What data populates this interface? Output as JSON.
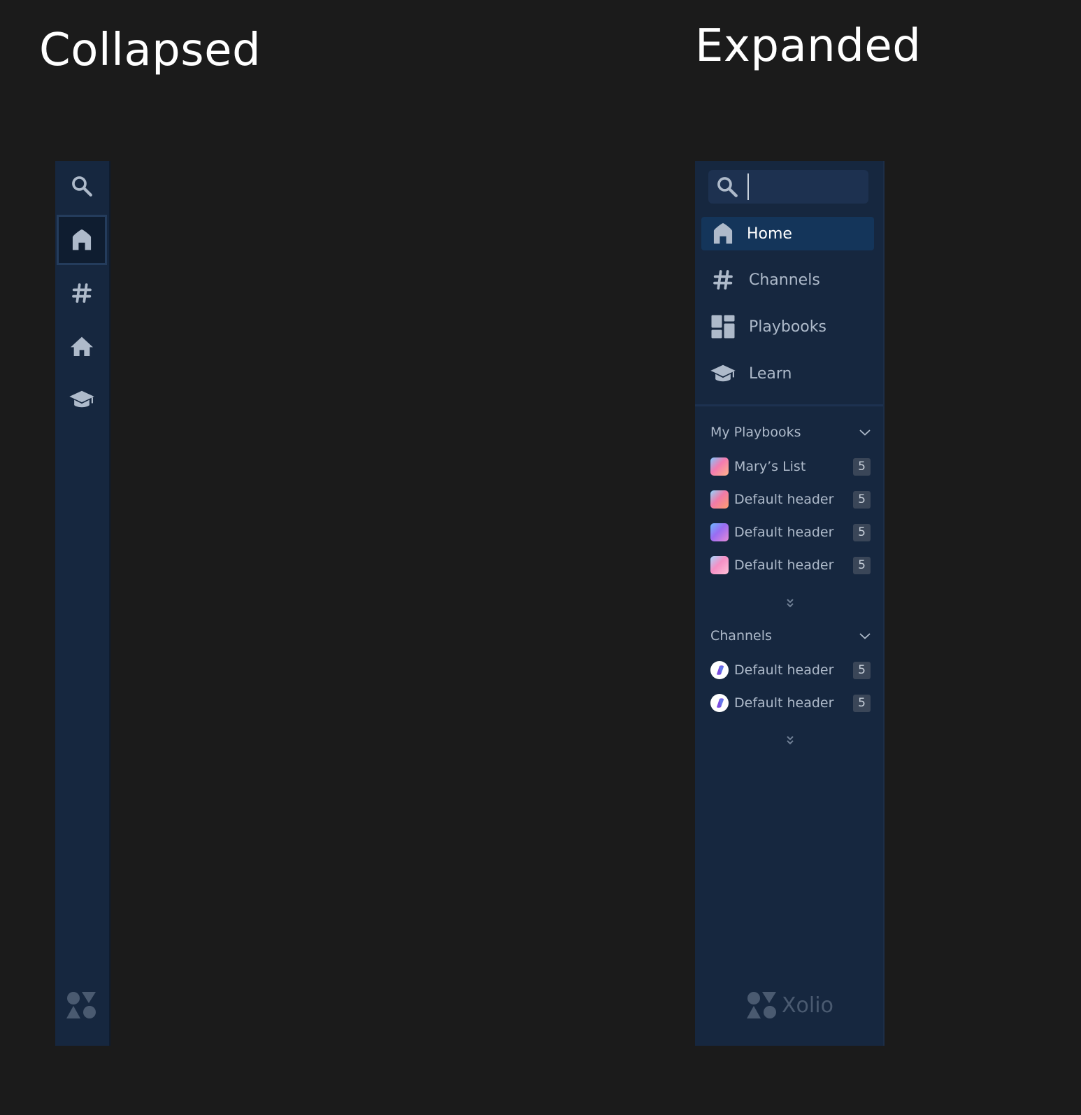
{
  "headings": {
    "collapsed": "Collapsed",
    "expanded": "Expanded"
  },
  "collapsed_sidebar": {
    "items": [
      {
        "icon": "search-icon"
      },
      {
        "icon": "home-icon",
        "active": true
      },
      {
        "icon": "hash-icon"
      },
      {
        "icon": "house-icon"
      },
      {
        "icon": "graduation-cap-icon"
      }
    ],
    "logo": "xolio-logo-icon"
  },
  "expanded_sidebar": {
    "search": {
      "value": "",
      "placeholder": ""
    },
    "nav": [
      {
        "label": "Home",
        "icon": "home-icon",
        "active": true
      },
      {
        "label": "Channels",
        "icon": "hash-icon"
      },
      {
        "label": "Playbooks",
        "icon": "dashboard-icon"
      },
      {
        "label": "Learn",
        "icon": "graduation-cap-icon"
      }
    ],
    "my_playbooks": {
      "title": "My Playbooks",
      "items": [
        {
          "label": "Mary’s List",
          "badge": "5"
        },
        {
          "label": "Default header",
          "badge": "5"
        },
        {
          "label": "Default header",
          "badge": "5"
        },
        {
          "label": "Default header",
          "badge": "5"
        }
      ]
    },
    "channels": {
      "title": "Channels",
      "items": [
        {
          "label": "Default header",
          "badge": "5"
        },
        {
          "label": "Default header",
          "badge": "5"
        }
      ]
    },
    "brand": "Xolio"
  },
  "colors": {
    "background": "#1b1b1b",
    "sidebar": "#16273f",
    "active_item": "#14355a",
    "icon": "#aebaca",
    "text": "#aebaca"
  }
}
